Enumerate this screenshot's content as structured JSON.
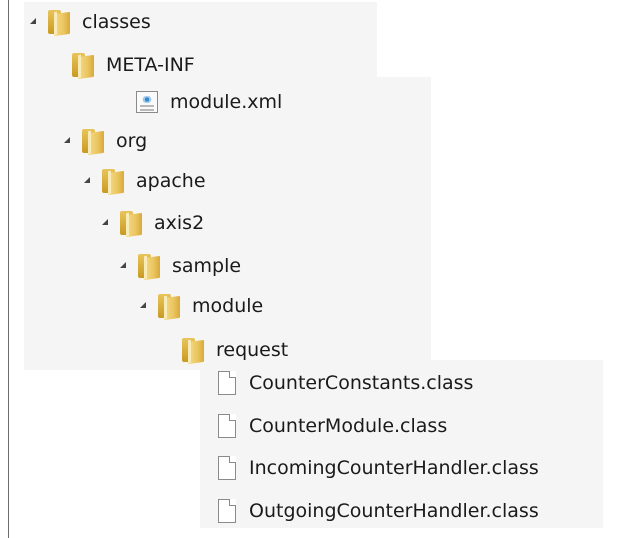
{
  "tree": {
    "nodes": [
      {
        "label": "classes",
        "type": "folder",
        "expanded": true
      },
      {
        "label": "META-INF",
        "type": "folder"
      },
      {
        "label": "module.xml",
        "type": "xml-file"
      },
      {
        "label": "org",
        "type": "folder",
        "expanded": true
      },
      {
        "label": "apache",
        "type": "folder",
        "expanded": true
      },
      {
        "label": "axis2",
        "type": "folder",
        "expanded": true
      },
      {
        "label": "sample",
        "type": "folder",
        "expanded": true
      },
      {
        "label": "module",
        "type": "folder",
        "expanded": true
      },
      {
        "label": "request",
        "type": "folder"
      },
      {
        "label": "CounterConstants.class",
        "type": "file"
      },
      {
        "label": "CounterModule.class",
        "type": "file"
      },
      {
        "label": "IncomingCounterHandler.class",
        "type": "file"
      },
      {
        "label": "OutgoingCounterHandler.class",
        "type": "file"
      }
    ]
  },
  "colors": {
    "background": "#ffffff",
    "band": "#f5f5f5",
    "text": "#1a1a1a",
    "folder": "#e8c55a"
  }
}
